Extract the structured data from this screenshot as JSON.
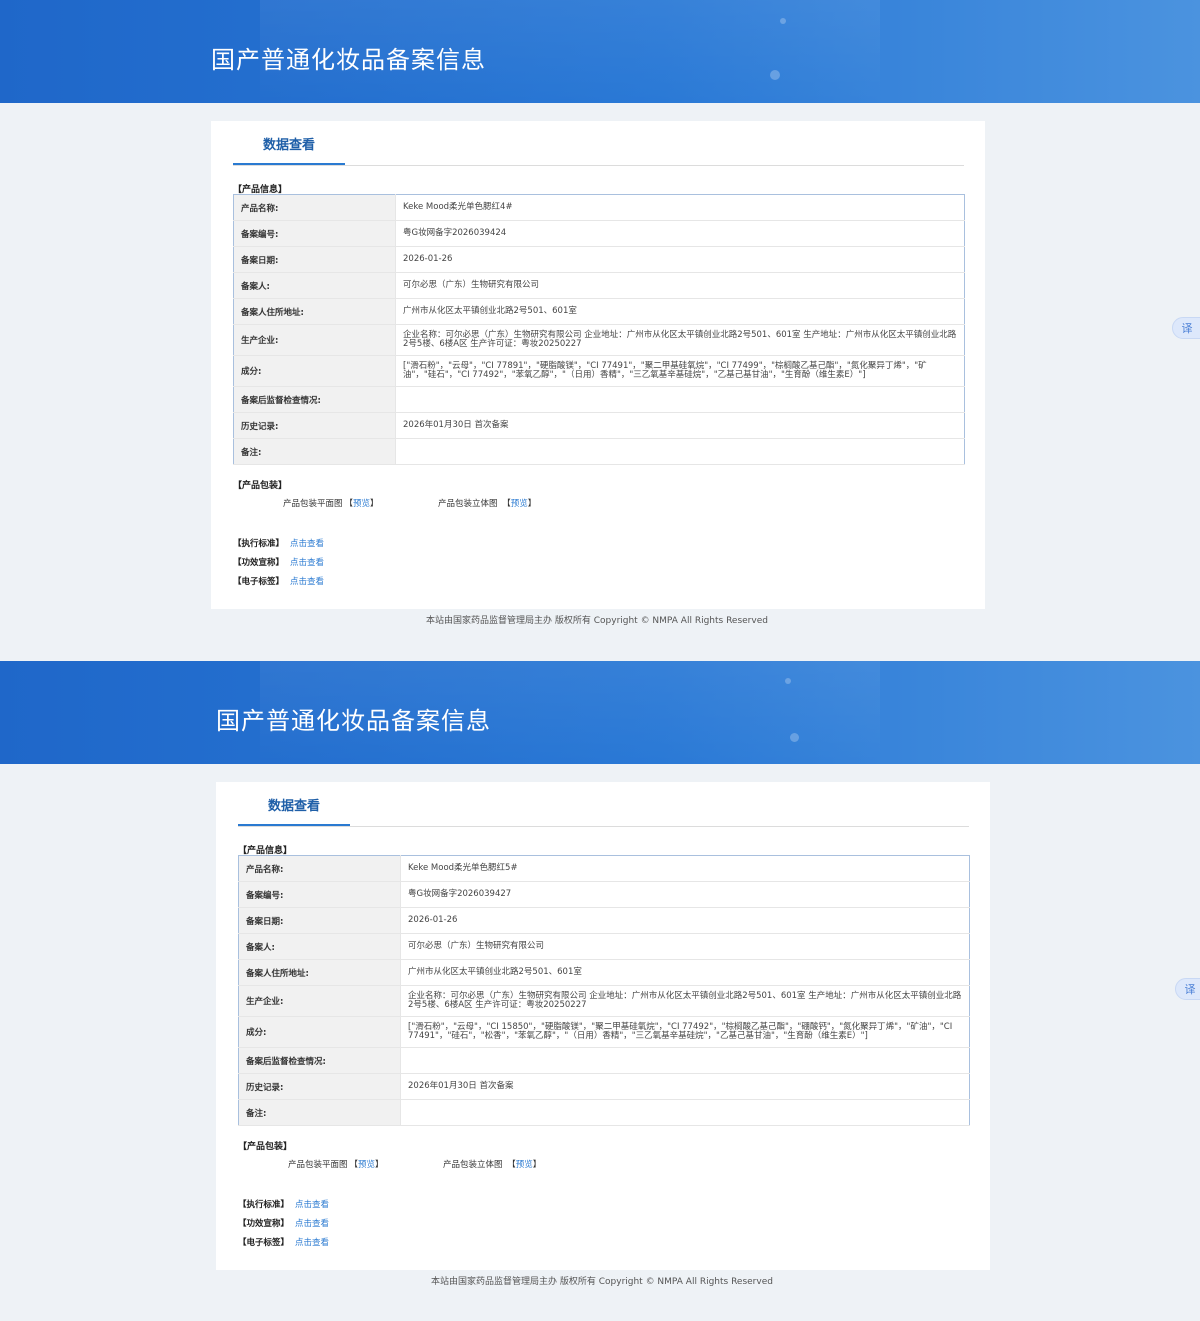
{
  "pages": [
    {
      "header_title": "国产普通化妆品备案信息",
      "tab_label": "数据查看",
      "product_section_title": "【产品信息】",
      "rows": [
        {
          "label": "产品名称:",
          "value": "Keke Mood柔光单色腮红4#"
        },
        {
          "label": "备案编号:",
          "value": "粤G妆网备字2026039424"
        },
        {
          "label": "备案日期:",
          "value": "2026-01-26"
        },
        {
          "label": "备案人:",
          "value": "可尔必思（广东）生物研究有限公司"
        },
        {
          "label": "备案人住所地址:",
          "value": "广州市从化区太平镇创业北路2号501、601室"
        },
        {
          "label": "生产企业:",
          "value": "企业名称：可尔必思（广东）生物研究有限公司 企业地址：广州市从化区太平镇创业北路2号501、601室 生产地址：广州市从化区太平镇创业北路2号5楼、6楼A区 生产许可证：粤妆20250227"
        },
        {
          "label": "成分:",
          "value": "[\"滑石粉\"，\"云母\"，\"CI 77891\"，\"硬脂酸镁\"，\"CI 77491\"，\"聚二甲基硅氧烷\"，\"CI 77499\"，\"棕榈酸乙基己酯\"，\"氮化聚异丁烯\"，\"矿油\"，\"硅石\"，\"CI 77492\"，\"苯氧乙醇\"，\"（日用）香精\"，\"三乙氧基辛基硅烷\"，\"乙基己基甘油\"，\"生育酚（维生素E）\"]"
        },
        {
          "label": "备案后监督检查情况:",
          "value": ""
        },
        {
          "label": "历史记录:",
          "value": "2026年01月30日 首次备案"
        },
        {
          "label": "备注:",
          "value": ""
        }
      ],
      "packaging_section_title": "【产品包装】",
      "pkg_flat_label": "产品包装平面图",
      "pkg_3d_label": "产品包装立体图",
      "preview_link": "预览",
      "bracket_left": "【",
      "bracket_right": "】",
      "standard_label": "【执行标准】",
      "efficacy_label": "【功效宣称】",
      "elabel_label": "【电子标签】",
      "view_link": "点击查看",
      "footer": "本站由国家药品监督管理局主办 版权所有 Copyright © NMPA All Rights Reserved",
      "translate_btn": "译"
    },
    {
      "header_title": "国产普通化妆品备案信息",
      "tab_label": "数据查看",
      "product_section_title": "【产品信息】",
      "rows": [
        {
          "label": "产品名称:",
          "value": "Keke Mood柔光单色腮红5#"
        },
        {
          "label": "备案编号:",
          "value": "粤G妆网备字2026039427"
        },
        {
          "label": "备案日期:",
          "value": "2026-01-26"
        },
        {
          "label": "备案人:",
          "value": "可尔必思（广东）生物研究有限公司"
        },
        {
          "label": "备案人住所地址:",
          "value": "广州市从化区太平镇创业北路2号501、601室"
        },
        {
          "label": "生产企业:",
          "value": "企业名称：可尔必思（广东）生物研究有限公司 企业地址：广州市从化区太平镇创业北路2号501、601室 生产地址：广州市从化区太平镇创业北路2号5楼、6楼A区 生产许可证：粤妆20250227"
        },
        {
          "label": "成分:",
          "value": "[\"滑石粉\"，\"云母\"，\"CI 15850\"，\"硬脂酸镁\"，\"聚二甲基硅氧烷\"，\"CI 77492\"，\"棕榈酸乙基己酯\"，\"硼酸钙\"，\"氮化聚异丁烯\"，\"矿油\"，\"CI 77491\"，\"硅石\"，\"松香\"，\"苯氧乙醇\"，\"（日用）香精\"，\"三乙氧基辛基硅烷\"，\"乙基己基甘油\"，\"生育酚（维生素E）\"]"
        },
        {
          "label": "备案后监督检查情况:",
          "value": ""
        },
        {
          "label": "历史记录:",
          "value": "2026年01月30日 首次备案"
        },
        {
          "label": "备注:",
          "value": ""
        }
      ],
      "packaging_section_title": "【产品包装】",
      "pkg_flat_label": "产品包装平面图",
      "pkg_3d_label": "产品包装立体图",
      "preview_link": "预览",
      "bracket_left": "【",
      "bracket_right": "】",
      "standard_label": "【执行标准】",
      "efficacy_label": "【功效宣称】",
      "elabel_label": "【电子标签】",
      "view_link": "点击查看",
      "footer": "本站由国家药品监督管理局主办 版权所有 Copyright © NMPA All Rights Reserved",
      "translate_btn": "译"
    }
  ]
}
